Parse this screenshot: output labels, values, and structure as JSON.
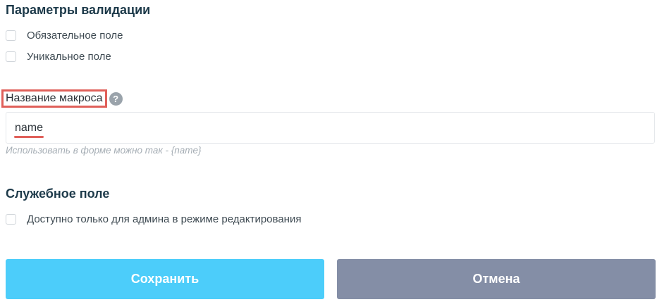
{
  "validation": {
    "title": "Параметры валидации",
    "options": [
      {
        "label": "Обязательное поле",
        "checked": false
      },
      {
        "label": "Уникальное поле",
        "checked": false
      }
    ]
  },
  "macro": {
    "label": "Название макроса",
    "help_icon": "?",
    "value": "name",
    "hint": "Использовать в форме можно так - {name}"
  },
  "service": {
    "title": "Служебное поле",
    "options": [
      {
        "label": "Доступно только для админа в режиме редактирования",
        "checked": false
      }
    ]
  },
  "actions": {
    "save_label": "Сохранить",
    "cancel_label": "Отмена"
  },
  "colors": {
    "title": "#1d3a4a",
    "highlight": "#e0605a",
    "save_button": "#4ccdfa",
    "cancel_button": "#848ea6",
    "hint": "#a6aeb5"
  }
}
